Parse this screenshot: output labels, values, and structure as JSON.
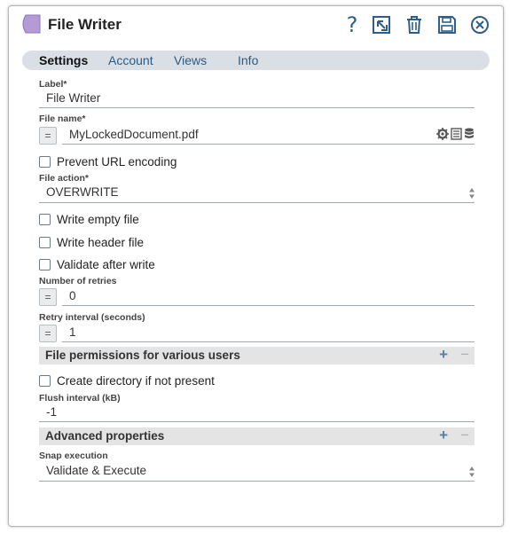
{
  "window": {
    "title": "File Writer"
  },
  "header": {
    "buttons": [
      {
        "name": "help",
        "glyph": "?"
      },
      {
        "name": "export"
      },
      {
        "name": "delete"
      },
      {
        "name": "save"
      },
      {
        "name": "close"
      }
    ]
  },
  "tabs": [
    "Settings",
    "Account",
    "Views",
    "Info"
  ],
  "active_tab": "Settings",
  "fields": {
    "label": {
      "label": "Label*",
      "value": "File Writer"
    },
    "file_name": {
      "label": "File name*",
      "value": "MyLockedDocument.pdf",
      "expr_button": "="
    },
    "prevent_url_encoding": {
      "label": "Prevent URL encoding",
      "checked": false
    },
    "file_action": {
      "label": "File action*",
      "value": "OVERWRITE"
    },
    "write_empty_file": {
      "label": "Write empty file",
      "checked": false
    },
    "write_header_file": {
      "label": "Write header file",
      "checked": false
    },
    "validate_after_write": {
      "label": "Validate after write",
      "checked": false
    },
    "number_of_retries": {
      "label": "Number of retries",
      "value": "0",
      "expr_button": "="
    },
    "retry_interval": {
      "label": "Retry interval (seconds)",
      "value": "1",
      "expr_button": "="
    },
    "file_permissions": {
      "title": "File permissions for various users",
      "add": "+",
      "remove": "−"
    },
    "create_directory": {
      "label": "Create directory if not present",
      "checked": false
    },
    "flush_interval": {
      "label": "Flush interval (kB)",
      "value": "-1"
    },
    "advanced_properties": {
      "title": "Advanced properties",
      "add": "+",
      "remove": "−"
    },
    "snap_execution": {
      "label": "Snap execution",
      "value": "Validate & Execute"
    }
  },
  "colors": {
    "snap_icon": "#b49ad6",
    "header_icons": "#2e5f8a",
    "tabs_bg": "#d9dfe4",
    "section_bg": "#e4e4e4"
  }
}
